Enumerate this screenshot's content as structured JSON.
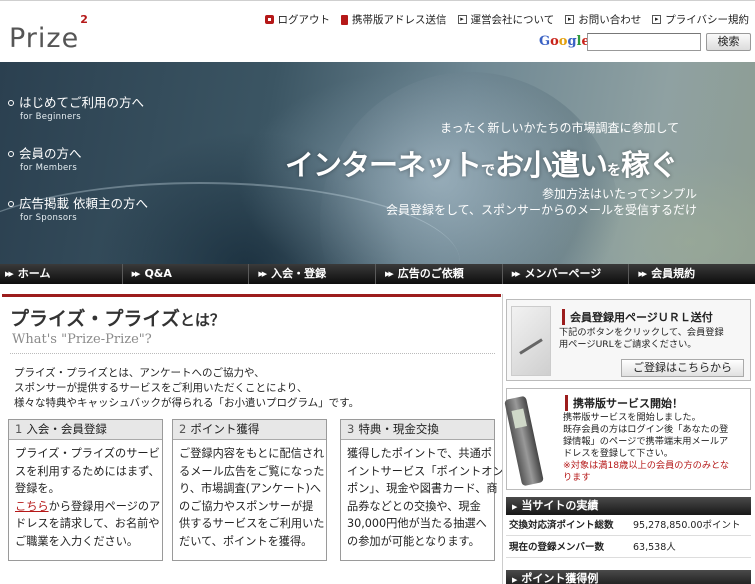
{
  "brand": {
    "logo_text": "Prize",
    "logo_sup": "2"
  },
  "topnav": [
    {
      "label": "ログアウト",
      "icon": "logout-icon"
    },
    {
      "label": "携帯版アドレス送信",
      "icon": "mobile-phone-icon"
    },
    {
      "label": "運営会社について",
      "icon": "arrow-box-icon"
    },
    {
      "label": "お問い合わせ",
      "icon": "arrow-box-icon"
    },
    {
      "label": "プライバシー規約",
      "icon": "arrow-box-icon"
    }
  ],
  "search": {
    "engine": "Google",
    "value": "",
    "button": "検索"
  },
  "hero": {
    "menu": [
      {
        "label": "はじめてご利用の方へ",
        "sub": "for Beginners"
      },
      {
        "label": "会員の方へ",
        "sub": "for Members"
      },
      {
        "label": "広告掲載 依頼主の方へ",
        "sub": "for Sponsors"
      }
    ],
    "lead": "まったく新しいかたちの市場調査に参加して",
    "copy_1": "インターネット",
    "copy_2": "で",
    "copy_3": "お小遣い",
    "copy_4": "を",
    "copy_5": "稼ぐ",
    "sub_1": "参加方法はいたってシンプル",
    "sub_2": "会員登録をして、スポンサーからのメールを受信するだけ"
  },
  "nav": [
    "ホーム",
    "Q&A",
    "入会・登録",
    "広告のご依頼",
    "メンバーページ",
    "会員規約"
  ],
  "main": {
    "title": "プライズ・プライズ",
    "title_suffix": "とは？",
    "subtitle": "What's \"Prize-Prize\"?",
    "intro": [
      "プライズ・プライズとは、アンケートへのご協力や、",
      "スポンサーが提供するサービスをご利用いただくことにより、",
      "様々な特典やキャッシュバックが得られる「お小遣いプログラム」です。"
    ],
    "steps": [
      {
        "num": "1",
        "title": "入会・会員登録",
        "lines_pre": [
          "プライズ・プライズのサービ",
          "スを利用するためにはまず、",
          "登録を。"
        ],
        "link": "こちら",
        "link_tail": "から登録用ページのア",
        "lines_post": [
          "ドレスを請求して、お名前や",
          "ご職業を入力ください。"
        ]
      },
      {
        "num": "2",
        "title": "ポイント獲得",
        "lines": [
          "ご登録内容をもとに配信され",
          "るメール広告をご覧になった",
          "り、市場調査(アンケート)へ",
          "のご協力やスポンサーが提",
          "供するサービスをご利用いた",
          "だいて、ポイントを獲得。"
        ]
      },
      {
        "num": "3",
        "title": "特典・現金交換",
        "lines": [
          "獲得したポイントで、共通ポ",
          "イントサービス「ポイントオン・",
          "ポン」、現金や図書カード、商",
          "品券などとの交換や、現金",
          "30,000円他が当たる抽選へ",
          "の参加が可能となります。"
        ]
      }
    ]
  },
  "sidebar": {
    "register": {
      "title": "会員登録用ページＵＲＬ送付",
      "body": [
        "下記のボタンをクリックして、会員登録",
        "用ページURLをご請求ください。"
      ],
      "button": "ご登録はこちらから"
    },
    "mobile": {
      "title": "携帯版サービス開始！",
      "body": [
        "携帯版サービスを開始しました。",
        "既存会員の方はログイン後「あなたの登",
        "録情報」のページで携帯端末用メールア",
        "ドレスを登録して下さい。"
      ],
      "note": [
        "※対象は満18歳以上の会員の方のみとな",
        "ります"
      ]
    },
    "stats": {
      "heading": "当サイトの実績",
      "rows": [
        {
          "label": "交換対応済ポイント総数",
          "value": "95,278,850.00ポイント"
        },
        {
          "label": "現在の登録メンバー数",
          "value": "63,538人"
        }
      ]
    },
    "examples_heading": "ポイント獲得例"
  },
  "colors": {
    "accent": "#9c1d1d",
    "link": "#b51818",
    "navbar": "#1a1a1a"
  }
}
